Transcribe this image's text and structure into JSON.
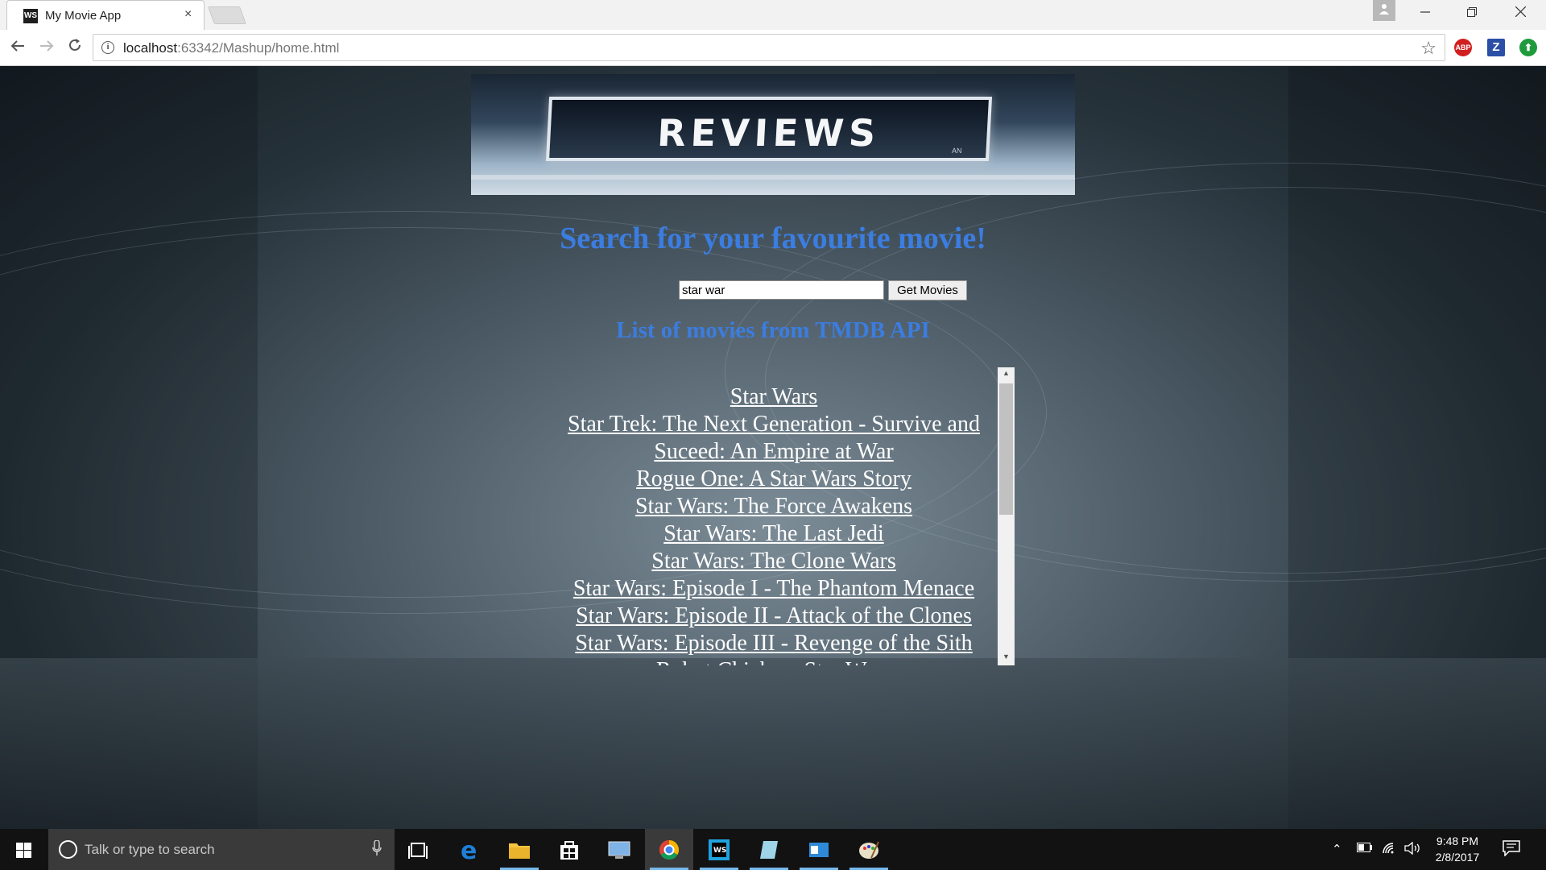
{
  "browser": {
    "tab_title": "My Movie App",
    "tab_favicon": "WS",
    "tab_close": "×",
    "url_host": "localhost",
    "url_rest": ":63342/Mashup/home.html",
    "extensions": [
      "ABP",
      "Z",
      "⬆"
    ]
  },
  "page": {
    "banner_title": "REVIEWS",
    "banner_sub": "AN",
    "heading": "Search for your favourite movie!",
    "search_value": "star war",
    "search_button": "Get Movies",
    "list_heading": "List of movies from TMDB API",
    "movies": [
      "Star Wars",
      "Star Trek: The Next Generation - Survive and Suceed: An Empire at War",
      "Rogue One: A Star Wars Story",
      "Star Wars: The Force Awakens",
      "Star Wars: The Last Jedi",
      "Star Wars: The Clone Wars",
      "Star Wars: Episode I - The Phantom Menace",
      "Star Wars: Episode II - Attack of the Clones",
      "Star Wars: Episode III - Revenge of the Sith",
      "Robot Chicken: Star Wars"
    ]
  },
  "taskbar": {
    "search_placeholder": "Talk or type to search",
    "time": "9:48 PM",
    "date": "2/8/2017"
  },
  "colors": {
    "heading": "#3b7de0",
    "link": "#ffffff",
    "taskbar": "#121212"
  }
}
